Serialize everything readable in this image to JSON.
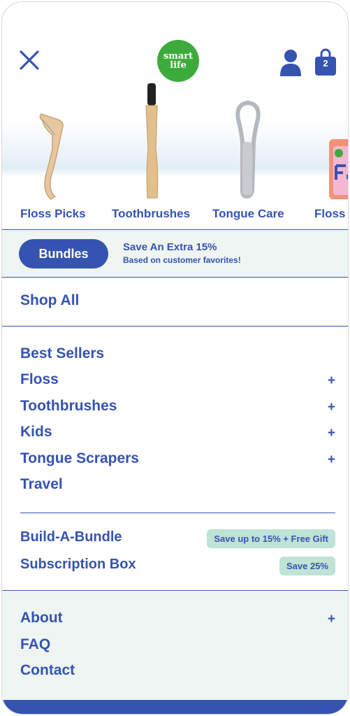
{
  "header": {
    "logo_text_line1": "smart",
    "logo_text_line2": "life",
    "cart_count": "2"
  },
  "categories": [
    {
      "label": "Floss Picks",
      "icon": "floss-pick-icon"
    },
    {
      "label": "Toothbrushes",
      "icon": "toothbrush-icon"
    },
    {
      "label": "Tongue Care",
      "icon": "tongue-scraper-icon"
    },
    {
      "label": "Floss S",
      "icon": "floss-box-icon"
    }
  ],
  "banner": {
    "button_label": "Bundles",
    "title": "Save An Extra 15%",
    "subtitle": "Based on customer favorites!"
  },
  "shop_all": "Shop All",
  "menu": [
    {
      "label": "Best Sellers",
      "expandable": false
    },
    {
      "label": "Floss",
      "expandable": true
    },
    {
      "label": "Toothbrushes",
      "expandable": true
    },
    {
      "label": "Kids",
      "expandable": true
    },
    {
      "label": "Tongue Scrapers",
      "expandable": true
    },
    {
      "label": "Travel",
      "expandable": false
    }
  ],
  "offers": [
    {
      "label": "Build-A-Bundle",
      "badge": "Save up to 15% + Free Gift"
    },
    {
      "label": "Subscription Box",
      "badge": "Save 25%"
    }
  ],
  "footer_menu": [
    {
      "label": "About",
      "expandable": true
    },
    {
      "label": "FAQ",
      "expandable": false
    },
    {
      "label": "Contact",
      "expandable": false
    }
  ],
  "plus_symbol": "+",
  "colors": {
    "brand_blue": "#3553b0",
    "logo_green": "#3cab3b",
    "badge_mint": "#bfe3d6",
    "section_tint": "#eef5f2"
  }
}
